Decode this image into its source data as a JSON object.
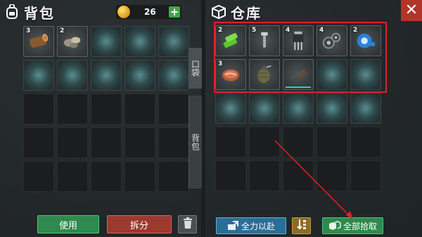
{
  "backpack": {
    "title": "背包",
    "coins": "26",
    "add_label": "+",
    "tabs": {
      "pocket": "口袋",
      "backpack": "背包"
    },
    "slots": [
      {
        "kind": "item",
        "count": "3",
        "icon": "log-icon"
      },
      {
        "kind": "item",
        "count": "2",
        "icon": "stones-icon"
      },
      {
        "kind": "glow"
      },
      {
        "kind": "glow"
      },
      {
        "kind": "glow"
      },
      {
        "kind": "glow"
      },
      {
        "kind": "glow"
      },
      {
        "kind": "glow"
      },
      {
        "kind": "glow"
      },
      {
        "kind": "glow"
      },
      {
        "kind": "dark"
      },
      {
        "kind": "dark"
      },
      {
        "kind": "dark"
      },
      {
        "kind": "dark"
      },
      {
        "kind": "dark"
      },
      {
        "kind": "dark"
      },
      {
        "kind": "dark"
      },
      {
        "kind": "dark"
      },
      {
        "kind": "dark"
      },
      {
        "kind": "dark"
      },
      {
        "kind": "dark"
      },
      {
        "kind": "dark"
      },
      {
        "kind": "dark"
      },
      {
        "kind": "dark"
      },
      {
        "kind": "dark"
      }
    ],
    "buttons": {
      "use": "使用",
      "split": "拆分"
    }
  },
  "storage": {
    "title": "仓库",
    "close_label": "✕",
    "slots": [
      {
        "kind": "item",
        "count": "2",
        "icon": "battery-icon"
      },
      {
        "kind": "item",
        "count": "5",
        "icon": "bolts-icon"
      },
      {
        "kind": "item",
        "count": "4",
        "icon": "chip-icon"
      },
      {
        "kind": "item",
        "count": "4",
        "icon": "gears-icon"
      },
      {
        "kind": "item",
        "count": "2",
        "icon": "tape-icon"
      },
      {
        "kind": "item",
        "count": "3",
        "icon": "meat-icon"
      },
      {
        "kind": "item",
        "count": "",
        "icon": "grenade-icon"
      },
      {
        "kind": "item",
        "count": "",
        "icon": "shotgun-icon",
        "durability": 1.0
      },
      {
        "kind": "glow"
      },
      {
        "kind": "glow"
      },
      {
        "kind": "glow"
      },
      {
        "kind": "glow"
      },
      {
        "kind": "glow"
      },
      {
        "kind": "glow"
      },
      {
        "kind": "glow"
      },
      {
        "kind": "dark"
      },
      {
        "kind": "dark"
      },
      {
        "kind": "dark"
      },
      {
        "kind": "dark"
      },
      {
        "kind": "dark"
      },
      {
        "kind": "dark"
      },
      {
        "kind": "dark"
      },
      {
        "kind": "dark"
      },
      {
        "kind": "dark"
      },
      {
        "kind": "dark"
      }
    ],
    "buttons": {
      "all_out": "全力以赴",
      "pick_all": "全部拾取"
    }
  },
  "colors": {
    "highlight": "#e01f2a",
    "green_button": "#2e8a4e",
    "red_button": "#9c3a30",
    "blue_button": "#2b6e95",
    "close": "#b2352b"
  }
}
